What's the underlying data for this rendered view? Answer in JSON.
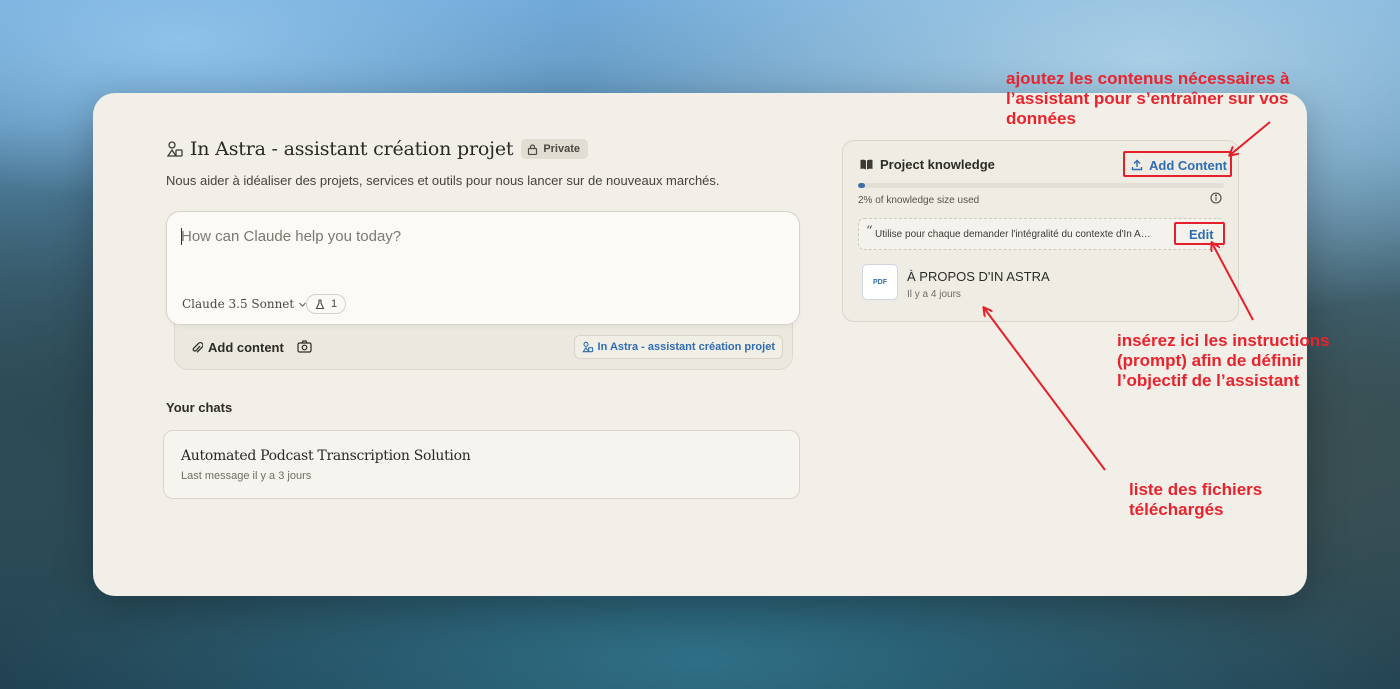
{
  "project": {
    "title": "In Astra - assistant création projet",
    "badge": "Private",
    "description": "Nous aider à idéaliser des projets, services et outils pour nous lancer sur de nouveaux marchés."
  },
  "composer": {
    "placeholder": "How can Claude help you today?",
    "model": "Claude 3.5 Sonnet",
    "style_count": "1",
    "add_content_label": "Add content",
    "project_chip": "In Astra - assistant création projet"
  },
  "chats": {
    "heading": "Your chats",
    "items": [
      {
        "title": "Automated Podcast Transcription Solution",
        "meta": "Last message il y a 3 jours"
      }
    ]
  },
  "knowledge": {
    "title": "Project knowledge",
    "add_label": "Add Content",
    "usage_percent": 2,
    "usage_text": "2% of knowledge size used",
    "prompt_quote": "“",
    "prompt_text": "Utilise pour chaque demander l'intégralité du contexte d'In Astra pour",
    "edit_label": "Edit",
    "files": [
      {
        "type": "PDF",
        "name": "À PROPOS D'IN ASTRA",
        "date": "Il y a 4 jours"
      }
    ]
  },
  "annotations": {
    "add_content_note": [
      "ajoutez les contenus nécessaires à",
      "l’assistant pour s’entraîner sur vos",
      "données"
    ],
    "prompt_note": [
      "insérez ici les instructions",
      "(prompt) afin de définir",
      "l’objectif de l’assistant"
    ],
    "files_note": [
      "liste des fichiers",
      "téléchargés"
    ]
  },
  "colors": {
    "accent": "#2f6db3",
    "annotation_red": "#e5202a",
    "card_bg": "#f1efe7"
  }
}
